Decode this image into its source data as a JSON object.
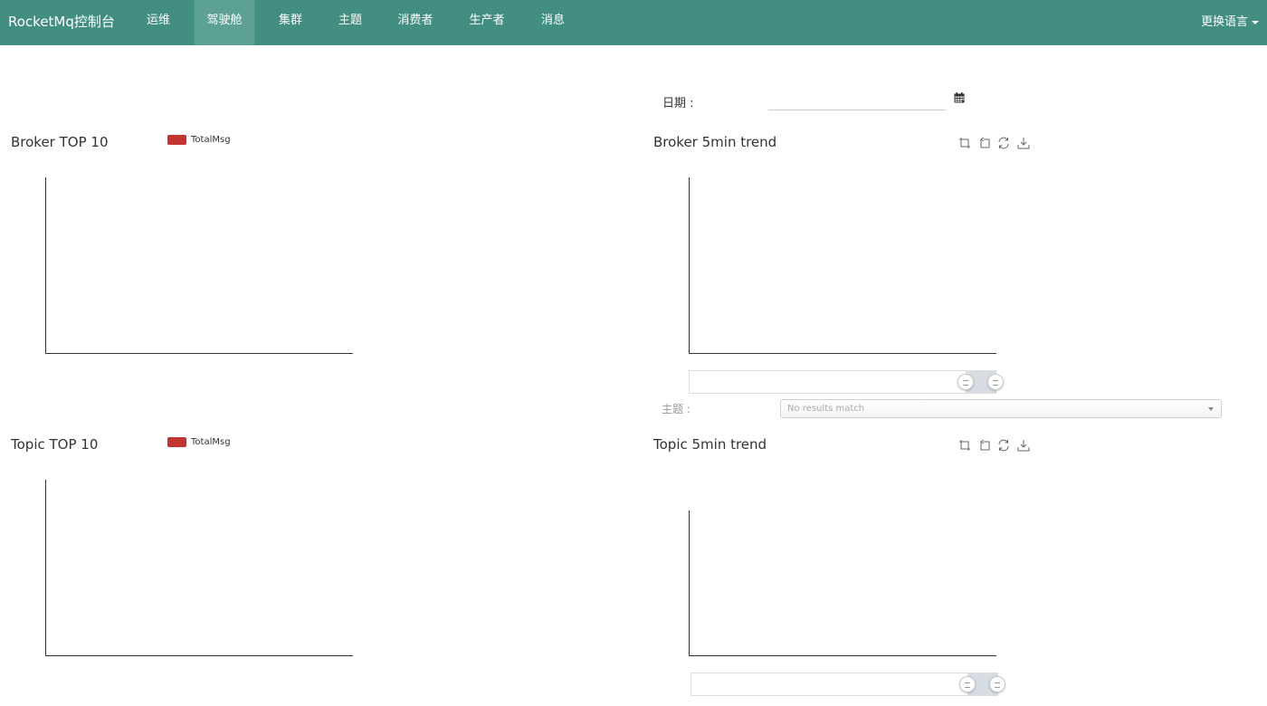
{
  "navbar": {
    "brand": "RocketMq控制台",
    "items": [
      {
        "label": "运维"
      },
      {
        "label": "驾驶舱"
      },
      {
        "label": "集群"
      },
      {
        "label": "主题"
      },
      {
        "label": "消费者"
      },
      {
        "label": "生产者"
      },
      {
        "label": "消息"
      }
    ],
    "active_index": 1,
    "language": "更换语言",
    "bg_color": "#428f82",
    "active_color": "#5da194"
  },
  "date": {
    "label": "日期 :",
    "value": "",
    "icon": "calendar-icon"
  },
  "topic_filter": {
    "label": "主题 :",
    "placeholder": "No results match"
  },
  "charts": {
    "broker_top": {
      "title": "Broker TOP 10",
      "legend": "TotalMsg",
      "legend_color": "#c23531"
    },
    "broker_trend": {
      "title": "Broker 5min trend",
      "tools": [
        "data-zoom-icon",
        "zoom-reset-icon",
        "restore-icon",
        "save-image-icon"
      ]
    },
    "topic_top": {
      "title": "Topic TOP 10",
      "legend": "TotalMsg",
      "legend_color": "#c23531"
    },
    "topic_trend": {
      "title": "Topic 5min trend",
      "tools": [
        "data-zoom-icon",
        "zoom-reset-icon",
        "restore-icon",
        "save-image-icon"
      ]
    }
  },
  "chart_data": [
    {
      "type": "bar",
      "title": "Broker TOP 10",
      "series": [
        {
          "name": "TotalMsg",
          "values": []
        }
      ],
      "categories": []
    },
    {
      "type": "line",
      "title": "Broker 5min trend",
      "series": [],
      "x": []
    },
    {
      "type": "bar",
      "title": "Topic TOP 10",
      "series": [
        {
          "name": "TotalMsg",
          "values": []
        }
      ],
      "categories": []
    },
    {
      "type": "line",
      "title": "Topic 5min trend",
      "series": [],
      "x": []
    }
  ]
}
